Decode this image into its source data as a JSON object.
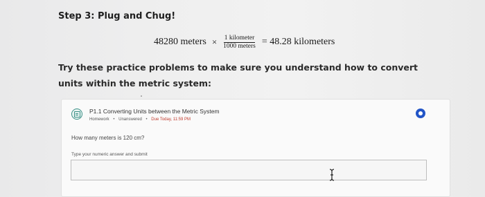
{
  "step": {
    "title": "Step 3: Plug and Chug!"
  },
  "equation": {
    "left": "48280 meters",
    "operator": "×",
    "numerator": "1 kilometer",
    "denominator": "1000 meters",
    "result": "= 48.28 kilometers"
  },
  "practice": {
    "text": "Try these practice problems to make sure you understand how to convert units within the metric system:"
  },
  "problem": {
    "title": "P1.1 Converting Units between the Metric System",
    "type": "Homework",
    "status": "Unanswered",
    "due": "Due Today, 11:59 PM",
    "question": "How many meters is 120 cm?",
    "answer_label": "Type your numeric answer and submit",
    "answer_value": "",
    "status_color": "#2255c7",
    "icon": "homework-icon"
  },
  "colors": {
    "accent": "#3a8f86",
    "due": "#c0392b"
  }
}
